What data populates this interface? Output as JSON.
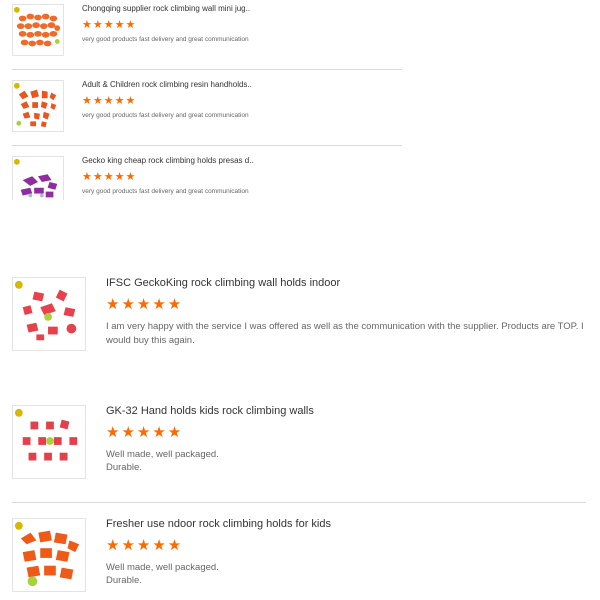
{
  "reviews": [
    {
      "title": "Chongqing supplier rock climbing wall mini jug..",
      "rating": 5,
      "stars": "★★★★★",
      "comment": "very good products fast delivery and great communication",
      "thumb_color": "#f06a2a"
    },
    {
      "title": "Adult & Children rock climbing resin handholds..",
      "rating": 5,
      "stars": "★★★★★",
      "comment": "very good products fast delivery and great communication",
      "thumb_color": "#e8561e"
    },
    {
      "title": "Gecko king cheap rock climbing holds presas d..",
      "rating": 5,
      "stars": "★★★★★",
      "comment": "very good products fast delivery and great communication",
      "thumb_color": "#8e2d9e"
    },
    {
      "title": "IFSC GeckoKing rock climbing wall holds indoor",
      "rating": 5,
      "stars": "★★★★★",
      "comment": "I am very happy with the service I was offered as well as the communication with the supplier. Products are TOP. I would buy this again.",
      "thumb_color": "#e8414e"
    },
    {
      "title": "GK-32 Hand holds kids rock climbing walls",
      "rating": 5,
      "stars": "★★★★★",
      "comment": "Well made, well packaged.",
      "comment2": "Durable.",
      "thumb_color": "#e4404c"
    },
    {
      "title": "Fresher use ndoor rock climbing holds for kids",
      "rating": 5,
      "stars": "★★★★★",
      "comment": "Well made, well packaged.",
      "comment2": "Durable.",
      "thumb_color": "#ef5a18"
    }
  ],
  "colors": {
    "star": "#ff6a00",
    "divider": "#d9d9d9"
  }
}
